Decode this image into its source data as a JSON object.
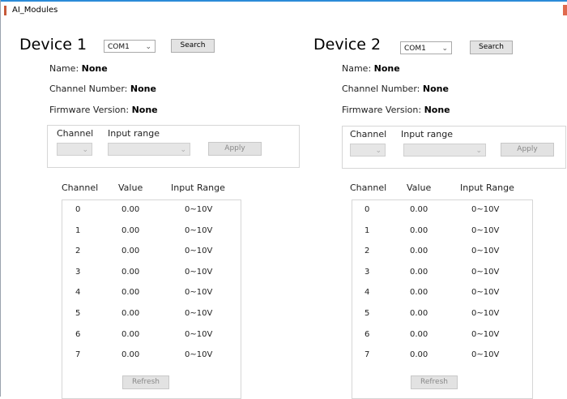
{
  "window": {
    "title": "AI_Modules"
  },
  "table_headers": {
    "channel": "Channel",
    "value": "Value",
    "input_range": "Input Range"
  },
  "labels": {
    "name": "Name:",
    "channel_number": "Channel Number:",
    "firmware_version": "Firmware Version:",
    "channel": "Channel",
    "input_range": "Input range",
    "search": "Search",
    "apply": "Apply",
    "refresh": "Refresh"
  },
  "devices": [
    {
      "title": "Device 1",
      "port": "COM1",
      "name": "None",
      "channel_number": "None",
      "firmware_version": "None",
      "rows": [
        {
          "ch": "0",
          "val": "0.00",
          "range": "0~10V"
        },
        {
          "ch": "1",
          "val": "0.00",
          "range": "0~10V"
        },
        {
          "ch": "2",
          "val": "0.00",
          "range": "0~10V"
        },
        {
          "ch": "3",
          "val": "0.00",
          "range": "0~10V"
        },
        {
          "ch": "4",
          "val": "0.00",
          "range": "0~10V"
        },
        {
          "ch": "5",
          "val": "0.00",
          "range": "0~10V"
        },
        {
          "ch": "6",
          "val": "0.00",
          "range": "0~10V"
        },
        {
          "ch": "7",
          "val": "0.00",
          "range": "0~10V"
        }
      ]
    },
    {
      "title": "Device 2",
      "port": "COM1",
      "name": "None",
      "channel_number": "None",
      "firmware_version": "None",
      "rows": [
        {
          "ch": "0",
          "val": "0.00",
          "range": "0~10V"
        },
        {
          "ch": "1",
          "val": "0.00",
          "range": "0~10V"
        },
        {
          "ch": "2",
          "val": "0.00",
          "range": "0~10V"
        },
        {
          "ch": "3",
          "val": "0.00",
          "range": "0~10V"
        },
        {
          "ch": "4",
          "val": "0.00",
          "range": "0~10V"
        },
        {
          "ch": "5",
          "val": "0.00",
          "range": "0~10V"
        },
        {
          "ch": "6",
          "val": "0.00",
          "range": "0~10V"
        },
        {
          "ch": "7",
          "val": "0.00",
          "range": "0~10V"
        }
      ]
    }
  ]
}
